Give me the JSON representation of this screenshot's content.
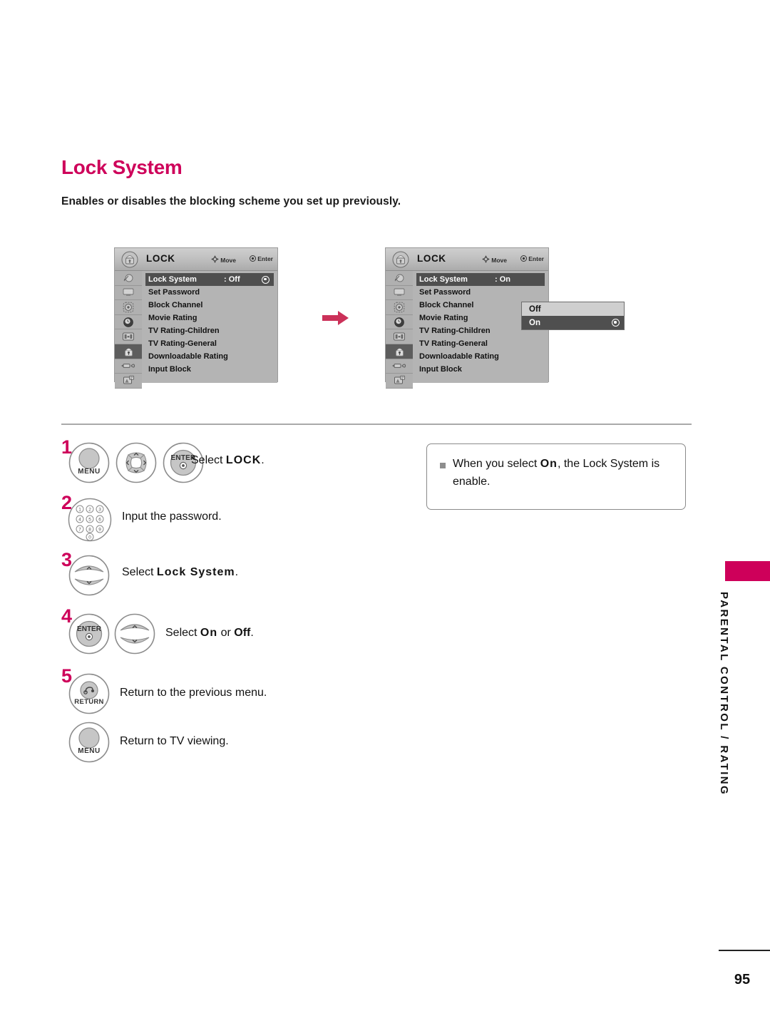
{
  "page": {
    "title": "Lock System",
    "subtitle": "Enables or disables the blocking scheme you set up previously.",
    "number": "95",
    "side_tab_label": "PARENTAL CONTROL / RATING",
    "accent_color": "#CE005A"
  },
  "osd": {
    "header_title": "LOCK",
    "hint_move": "Move",
    "hint_enter": "Enter",
    "menu_items": [
      "Lock System",
      "Set Password",
      "Block Channel",
      "Movie Rating",
      "TV Rating-Children",
      "TV Rating-General",
      "Downloadable Rating",
      "Input Block"
    ],
    "icons": [
      "lock-header-icon",
      "antenna-icon",
      "screen-icon",
      "target-icon",
      "clock-icon",
      "options-icon",
      "padlock-icon",
      "input-cable-icon",
      "usb-icon"
    ],
    "before": {
      "lock_system_value": ": Off"
    },
    "after": {
      "lock_system_value": ": On",
      "dropdown_options": [
        "Off",
        "On"
      ],
      "dropdown_selected": "On"
    }
  },
  "steps": [
    {
      "number": "1",
      "text_prefix": "Select ",
      "text_bold": "LOCK",
      "text_suffix": ".",
      "buttons": [
        "MENU",
        "nav-pad",
        "ENTER"
      ]
    },
    {
      "number": "2",
      "text_prefix": "Input the password.",
      "text_bold": "",
      "text_suffix": "",
      "buttons": [
        "number-keypad"
      ]
    },
    {
      "number": "3",
      "text_prefix": "Select ",
      "text_bold": "Lock System",
      "text_suffix": ".",
      "buttons": [
        "updown-pad"
      ]
    },
    {
      "number": "4",
      "text_prefix": "Select ",
      "text_bold": "On",
      "text_mid": " or ",
      "text_bold2": "Off",
      "text_suffix": ".",
      "buttons": [
        "ENTER",
        "updown-pad"
      ]
    },
    {
      "number": "5",
      "text_prefix": "Return to the previous menu.",
      "text_bold": "",
      "text_suffix": "",
      "buttons": [
        "RETURN"
      ]
    },
    {
      "number": "",
      "text_prefix": "Return to TV viewing.",
      "text_bold": "",
      "text_suffix": "",
      "buttons": [
        "MENU"
      ]
    }
  ],
  "button_labels": {
    "menu": "MENU",
    "enter": "ENTER",
    "return": "RETURN",
    "keypad_digits": [
      "1",
      "2",
      "3",
      "4",
      "5",
      "6",
      "7",
      "8",
      "9",
      "0"
    ]
  },
  "note": {
    "bullet_prefix": "When you select ",
    "bullet_bold": "On",
    "bullet_suffix": ", the Lock System is enable."
  }
}
